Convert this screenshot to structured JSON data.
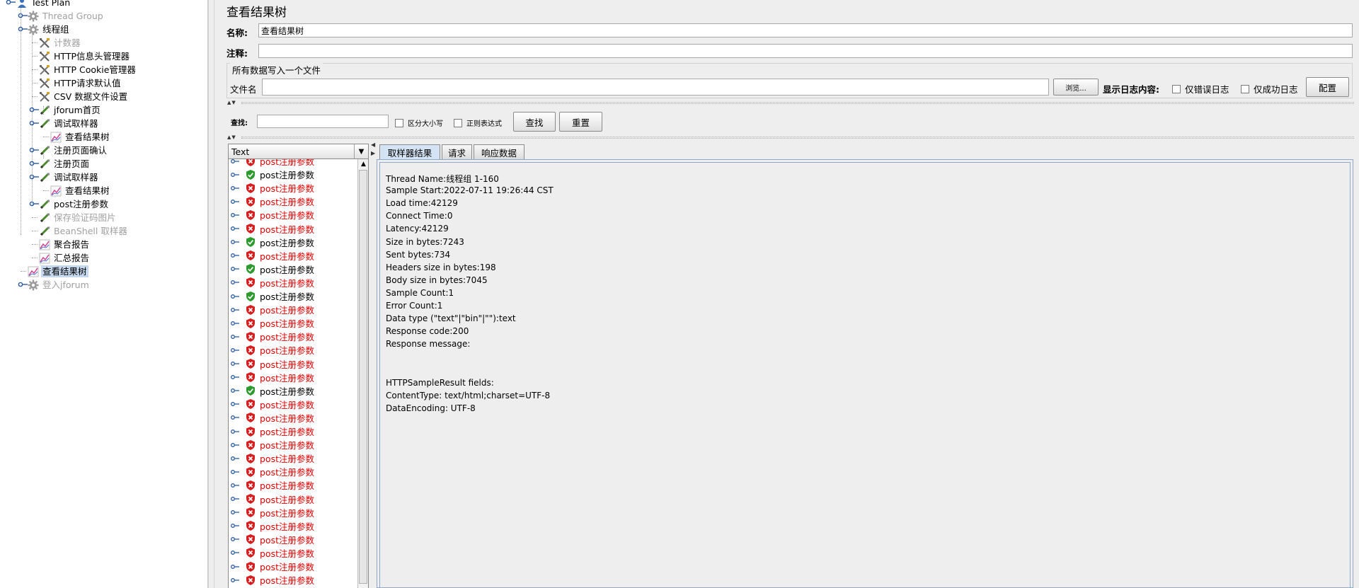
{
  "tree": {
    "items": [
      {
        "label": "Test Plan",
        "icon": "test-plan-icon",
        "disabled": false,
        "selected": false
      },
      {
        "label": "Thread Group",
        "icon": "gear-icon",
        "disabled": true,
        "selected": false
      },
      {
        "label": "线程组",
        "icon": "gear-icon",
        "disabled": false,
        "selected": false
      },
      {
        "label": "计数器",
        "icon": "config-tools-icon",
        "disabled": true,
        "selected": false
      },
      {
        "label": "HTTP信息头管理器",
        "icon": "config-tools-icon",
        "disabled": false,
        "selected": false
      },
      {
        "label": "HTTP Cookie管理器",
        "icon": "config-tools-icon",
        "disabled": false,
        "selected": false
      },
      {
        "label": "HTTP请求默认值",
        "icon": "config-tools-icon",
        "disabled": false,
        "selected": false
      },
      {
        "label": "CSV 数据文件设置",
        "icon": "config-tools-icon",
        "disabled": false,
        "selected": false
      },
      {
        "label": "jforum首页",
        "icon": "sampler-pen-icon",
        "disabled": false,
        "selected": false
      },
      {
        "label": "调试取样器",
        "icon": "sampler-pen-icon",
        "disabled": false,
        "selected": false
      },
      {
        "label": "查看结果树",
        "icon": "listener-graph-icon",
        "disabled": false,
        "selected": false
      },
      {
        "label": "注册页面确认",
        "icon": "sampler-pen-icon",
        "disabled": false,
        "selected": false
      },
      {
        "label": "注册页面",
        "icon": "sampler-pen-icon",
        "disabled": false,
        "selected": false
      },
      {
        "label": "调试取样器",
        "icon": "sampler-pen-icon",
        "disabled": false,
        "selected": false
      },
      {
        "label": "查看结果树",
        "icon": "listener-graph-icon",
        "disabled": false,
        "selected": false
      },
      {
        "label": "post注册参数",
        "icon": "sampler-pen-icon",
        "disabled": false,
        "selected": false
      },
      {
        "label": "保存验证码图片",
        "icon": "sampler-pen-icon",
        "disabled": true,
        "selected": false
      },
      {
        "label": "BeanShell 取样器",
        "icon": "sampler-pen-icon",
        "disabled": true,
        "selected": false
      },
      {
        "label": "聚合报告",
        "icon": "listener-graph-icon",
        "disabled": false,
        "selected": false
      },
      {
        "label": "汇总报告",
        "icon": "listener-graph-icon",
        "disabled": false,
        "selected": false
      },
      {
        "label": "查看结果树",
        "icon": "listener-graph-icon",
        "disabled": false,
        "selected": true
      },
      {
        "label": "登入jforum",
        "icon": "gear-icon",
        "disabled": true,
        "selected": false
      }
    ]
  },
  "panel": {
    "title": "查看结果树",
    "name_label": "名称:",
    "name_value": "查看结果树",
    "comment_label": "注释:",
    "comment_value": "",
    "file_group_title": "所有数据写入一个文件",
    "filename_label": "文件名",
    "filename_value": "",
    "browse_button": "浏览...",
    "log_display_label": "显示日志内容:",
    "errors_only_label": "仅错误日志",
    "success_only_label": "仅成功日志",
    "configure_button": "配置",
    "search_label": "查找:",
    "search_value": "",
    "case_sensitive_label": "区分大小写",
    "regex_label": "正则表达式",
    "find_button": "查找",
    "reset_button": "重置"
  },
  "results": {
    "column_header": "Text",
    "items": [
      {
        "label": "post注册参数",
        "status": "error"
      },
      {
        "label": "post注册参数",
        "status": "ok"
      },
      {
        "label": "post注册参数",
        "status": "error"
      },
      {
        "label": "post注册参数",
        "status": "error"
      },
      {
        "label": "post注册参数",
        "status": "error"
      },
      {
        "label": "post注册参数",
        "status": "error"
      },
      {
        "label": "post注册参数",
        "status": "ok"
      },
      {
        "label": "post注册参数",
        "status": "error"
      },
      {
        "label": "post注册参数",
        "status": "ok"
      },
      {
        "label": "post注册参数",
        "status": "error"
      },
      {
        "label": "post注册参数",
        "status": "ok"
      },
      {
        "label": "post注册参数",
        "status": "error"
      },
      {
        "label": "post注册参数",
        "status": "error"
      },
      {
        "label": "post注册参数",
        "status": "error"
      },
      {
        "label": "post注册参数",
        "status": "error"
      },
      {
        "label": "post注册参数",
        "status": "error"
      },
      {
        "label": "post注册参数",
        "status": "error"
      },
      {
        "label": "post注册参数",
        "status": "ok"
      },
      {
        "label": "post注册参数",
        "status": "error"
      },
      {
        "label": "post注册参数",
        "status": "error"
      },
      {
        "label": "post注册参数",
        "status": "error"
      },
      {
        "label": "post注册参数",
        "status": "error"
      },
      {
        "label": "post注册参数",
        "status": "error"
      },
      {
        "label": "post注册参数",
        "status": "error"
      },
      {
        "label": "post注册参数",
        "status": "error"
      },
      {
        "label": "post注册参数",
        "status": "error"
      },
      {
        "label": "post注册参数",
        "status": "error"
      },
      {
        "label": "post注册参数",
        "status": "error"
      },
      {
        "label": "post注册参数",
        "status": "error"
      },
      {
        "label": "post注册参数",
        "status": "error"
      },
      {
        "label": "post注册参数",
        "status": "error"
      },
      {
        "label": "post注册参数",
        "status": "error"
      }
    ]
  },
  "tabs": [
    "取样器结果",
    "请求",
    "响应数据"
  ],
  "sampler_result": {
    "lines": [
      "Thread Name:线程组 1-160",
      "Sample Start:2022-07-11 19:26:44 CST",
      "Load time:42129",
      "Connect Time:0",
      "Latency:42129",
      "Size in bytes:7243",
      "Sent bytes:734",
      "Headers size in bytes:198",
      "Body size in bytes:7045",
      "Sample Count:1",
      "Error Count:1",
      "Data type (\"text\"|\"bin\"|\"\"):text",
      "Response code:200",
      "Response message:",
      "",
      "",
      "HTTPSampleResult fields:",
      "ContentType: text/html;charset=UTF-8",
      "DataEncoding: UTF-8"
    ]
  },
  "colors": {
    "error_text": "#e00000",
    "selection": "#c5d8ee",
    "active_tab": "#d5e4f4"
  }
}
